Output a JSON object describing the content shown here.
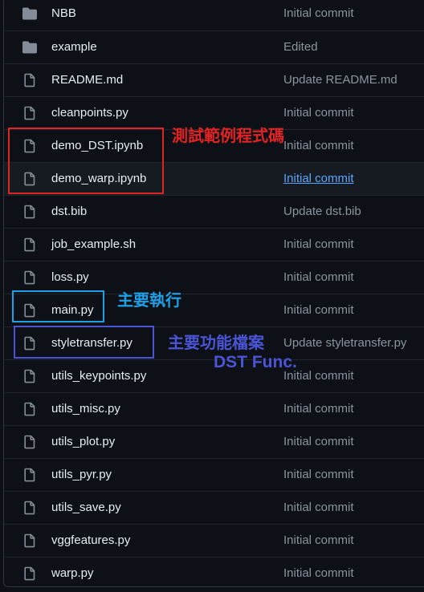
{
  "files": [
    {
      "name": "NBB",
      "type": "folder",
      "message": "Initial commit"
    },
    {
      "name": "example",
      "type": "folder",
      "message": "Edited"
    },
    {
      "name": "README.md",
      "type": "file",
      "message": "Update README.md"
    },
    {
      "name": "cleanpoints.py",
      "type": "file",
      "message": "Initial commit"
    },
    {
      "name": "demo_DST.ipynb",
      "type": "file",
      "message": "Initial commit"
    },
    {
      "name": "demo_warp.ipynb",
      "type": "file",
      "message": "Initial commit",
      "hovered": true
    },
    {
      "name": "dst.bib",
      "type": "file",
      "message": "Update dst.bib"
    },
    {
      "name": "job_example.sh",
      "type": "file",
      "message": "Initial commit"
    },
    {
      "name": "loss.py",
      "type": "file",
      "message": "Initial commit"
    },
    {
      "name": "main.py",
      "type": "file",
      "message": "Initial commit"
    },
    {
      "name": "styletransfer.py",
      "type": "file",
      "message": "Update styletransfer.py"
    },
    {
      "name": "utils_keypoints.py",
      "type": "file",
      "message": "Initial commit"
    },
    {
      "name": "utils_misc.py",
      "type": "file",
      "message": "Initial commit"
    },
    {
      "name": "utils_plot.py",
      "type": "file",
      "message": "Initial commit"
    },
    {
      "name": "utils_pyr.py",
      "type": "file",
      "message": "Initial commit"
    },
    {
      "name": "utils_save.py",
      "type": "file",
      "message": "Initial commit"
    },
    {
      "name": "vggfeatures.py",
      "type": "file",
      "message": "Initial commit"
    },
    {
      "name": "warp.py",
      "type": "file",
      "message": "Initial commit"
    }
  ],
  "annotations": {
    "demo": {
      "label": "測試範例程式碼",
      "color": "#e02424"
    },
    "main": {
      "label": "主要執行",
      "color": "#1da1e6"
    },
    "styletransfer": {
      "line1": "主要功能檔案",
      "line2": "DST Func.",
      "color": "#4a55d6"
    }
  },
  "colors": {
    "background": "#0d1117",
    "text": "#e6edf3",
    "muted": "#8b949e",
    "link": "#58a6ff",
    "border": "#21262d"
  }
}
